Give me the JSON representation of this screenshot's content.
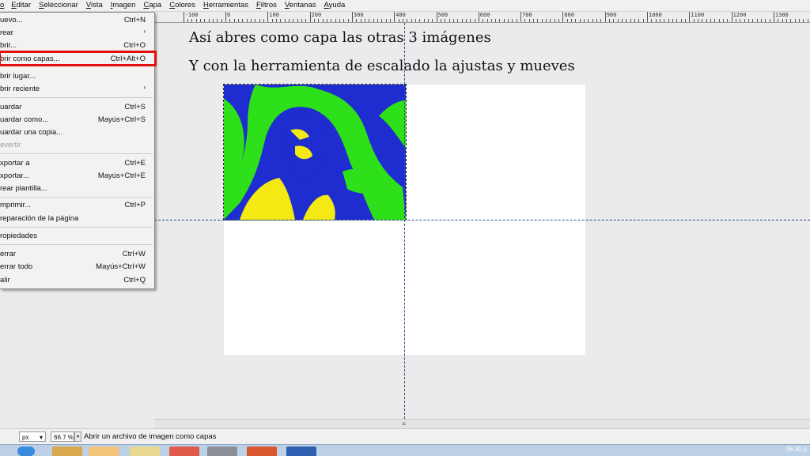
{
  "menubar": {
    "items": [
      "o",
      "Editar",
      "Seleccionar",
      "Vista",
      "Imagen",
      "Capa",
      "Colores",
      "Herramientas",
      "Filtros",
      "Ventanas",
      "Ayuda"
    ]
  },
  "ruler": {
    "labels": [
      "-100",
      "0",
      "100",
      "200",
      "300",
      "400",
      "500",
      "600",
      "700",
      "800",
      "900",
      "1000",
      "1100",
      "1200",
      "1300"
    ]
  },
  "canvas": {
    "line1": "Así abres como capa las otras 3 imágenes",
    "line2": "Y con la herramienta de escalado la ajustas y mueves"
  },
  "file_menu": {
    "items": [
      {
        "label": "uevo...",
        "shortcut": "Ctrl+N"
      },
      {
        "label": "rear",
        "submenu": "›"
      },
      {
        "label": "brir...",
        "shortcut": "Ctrl+O"
      },
      {
        "label": "brir como capas...",
        "shortcut": "Ctrl+Alt+O"
      },
      {
        "label": "brir lugar...",
        "shortcut": ""
      },
      {
        "label": "brir reciente",
        "submenu": "›"
      },
      {
        "label": "uardar",
        "shortcut": "Ctrl+S"
      },
      {
        "label": "uardar como...",
        "shortcut": "Mayús+Ctrl+S"
      },
      {
        "label": "uardar una copia...",
        "shortcut": ""
      },
      {
        "label": "evertir",
        "shortcut": ""
      },
      {
        "label": "xportar a",
        "shortcut": "Ctrl+E"
      },
      {
        "label": "xportar...",
        "shortcut": "Mayús+Ctrl+E"
      },
      {
        "label": "rear plantilla...",
        "shortcut": ""
      },
      {
        "label": "mprimir...",
        "shortcut": "Ctrl+P"
      },
      {
        "label": "reparación de la página",
        "shortcut": ""
      },
      {
        "label": "ropiedades",
        "shortcut": ""
      },
      {
        "label": "errar",
        "shortcut": "Ctrl+W"
      },
      {
        "label": "errar todo",
        "shortcut": "Mayús+Ctrl+W"
      },
      {
        "label": "alir",
        "shortcut": "Ctrl+Q"
      }
    ]
  },
  "statusbar": {
    "units": "px",
    "zoom": "66.7 %",
    "message": "Abrir un archivo de imagen como capas"
  },
  "taskbar": {
    "clock": "06:30 p"
  },
  "colors": {
    "highlight": "#e01010",
    "photo_blue": "#1f2ccf",
    "photo_green": "#2ee01a",
    "photo_yellow": "#f2ea12"
  },
  "icons": {
    "scroll_grip": "≡",
    "dropdown": "▾"
  }
}
